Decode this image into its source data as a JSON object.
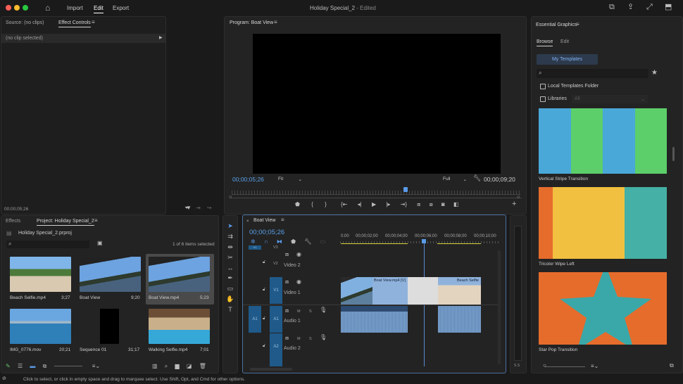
{
  "menu": {
    "import": "Import",
    "edit": "Edit",
    "export": "Export",
    "title": "Holiday Special_2",
    "title_status": "- Edited"
  },
  "source_panel": {
    "tab_source": "Source: (no clips)",
    "tab_effect_controls": "Effect Controls",
    "no_clip": "(no clip selected)",
    "timecode": "00;00;05;26"
  },
  "program": {
    "title": "Program: Boat View",
    "timecode": "00;00;05;26",
    "fit": "Fit",
    "quality": "Full",
    "duration": "00;00;09;20",
    "playhead_fraction": 0.6
  },
  "essential_graphics": {
    "title": "Essential Graphics",
    "tab_browse": "Browse",
    "tab_edit": "Edit",
    "my_templates": "My Templates",
    "local_folder": "Local Templates Folder",
    "libraries": "Libraries",
    "libraries_select": "All",
    "templates": [
      {
        "name": "Vertical Stripe Transition",
        "colors": [
          "#4aa8d8",
          "#5ccf6a",
          "#4aa8d8",
          "#5ccf6a"
        ]
      },
      {
        "name": "Tricolor Wipe Left",
        "colors": [
          "#e66c2c",
          "#f1c040",
          "#45b0a5"
        ]
      },
      {
        "name": "Star Pop Transition",
        "colors": [
          "#e66c2c",
          "#3aa8a8"
        ]
      }
    ]
  },
  "project": {
    "tab_effects": "Effects",
    "tab_project": "Project: Holiday Special_2",
    "file": "Holiday Special_2.prproj",
    "selection": "1 of 6 items selected",
    "items": [
      {
        "name": "Beach Selfie.mp4",
        "duration": "3;27"
      },
      {
        "name": "Boat View",
        "duration": "9;20"
      },
      {
        "name": "Boat View.mp4",
        "duration": "5;23",
        "selected": true
      },
      {
        "name": "IMG_0776.mov",
        "duration": "20;21"
      },
      {
        "name": "Sequence 01",
        "duration": "31;17"
      },
      {
        "name": "Walking Selfie.mp4",
        "duration": "7;01"
      }
    ]
  },
  "timeline": {
    "title": "Boat View",
    "timecode": "00;00;05;26",
    "ruler": [
      "0;00",
      "00;00;02;00",
      "00;00;04;00",
      "00;00;06;00",
      "00;00;08;00",
      "00;00;10;00"
    ],
    "tracks": {
      "v3": "V3",
      "v2": "V2",
      "v2_name": "Video 2",
      "v1": "V1",
      "v1_name": "Video 1",
      "a1": "A1",
      "a1_name": "Audio 1",
      "a2": "A2",
      "a2_name": "Audio 2",
      "src_v": "V1",
      "src_a": "A1",
      "m": "M",
      "s": "S"
    },
    "clips": {
      "boat": "Boat View.mp4 [V]",
      "beach": "Beach Selfie"
    }
  },
  "meter": {
    "labels": "S S"
  },
  "status": "Click to select, or click in empty space and drag to marquee select. Use Shift, Opt, and Cmd for other options."
}
